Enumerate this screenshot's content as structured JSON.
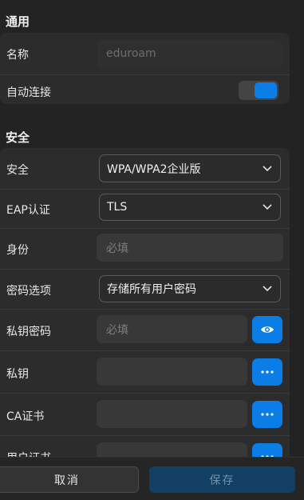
{
  "general": {
    "title": "通用",
    "name_label": "名称",
    "name_value": "eduroam",
    "autoconnect_label": "自动连接",
    "autoconnect_on": true
  },
  "security": {
    "title": "安全",
    "security_label": "安全",
    "security_value": "WPA/WPA2企业版",
    "eap_label": "EAP认证",
    "eap_value": "TLS",
    "identity_label": "身份",
    "identity_placeholder": "必填",
    "pwd_option_label": "密码选项",
    "pwd_option_value": "存储所有用户密码",
    "private_key_pwd_label": "私钥密码",
    "private_key_pwd_placeholder": "必填",
    "private_key_label": "私钥",
    "ca_cert_label": "CA证书",
    "user_cert_label": "用户证书"
  },
  "footer": {
    "cancel_label": "取消",
    "save_label": "保存"
  },
  "colors": {
    "accent": "#0a7de6",
    "background": "#232323",
    "card": "#2c2c2c"
  },
  "icons": {
    "dropdown": "chevron-down-icon",
    "reveal": "eye-icon",
    "browse": "more-dots-icon"
  }
}
